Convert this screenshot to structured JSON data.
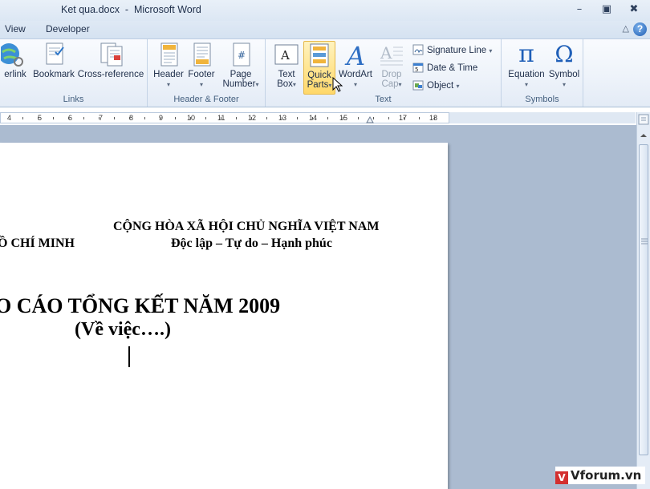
{
  "window": {
    "title": "Ket qua.docx  -  Microsoft Word",
    "controls": {
      "minimize": "–",
      "restore": "▣",
      "close": "✖"
    }
  },
  "tabs": [
    "View",
    "Developer"
  ],
  "help_label": "?",
  "ribbon": {
    "groups": {
      "links": {
        "label": "Links",
        "buttons": {
          "hyperlink": "erlink",
          "bookmark": "Bookmark",
          "cross_reference": "Cross-reference"
        }
      },
      "header_footer": {
        "label": "Header & Footer",
        "buttons": {
          "header": "Header",
          "footer": "Footer",
          "page_number_1": "Page",
          "page_number_2": "Number"
        }
      },
      "text": {
        "label": "Text",
        "buttons": {
          "text_box_1": "Text",
          "text_box_2": "Box",
          "quick_parts_1": "Quick",
          "quick_parts_2": "Parts",
          "wordart": "WordArt",
          "drop_cap_1": "Drop",
          "drop_cap_2": "Cap",
          "signature_line": "Signature Line",
          "date_time": "Date & Time",
          "object": "Object"
        }
      },
      "symbols": {
        "label": "Symbols",
        "buttons": {
          "equation": "Equation",
          "symbol": "Symbol",
          "pi_glyph": "π",
          "omega_glyph": "Ω"
        }
      }
    }
  },
  "ruler": {
    "numbers": [
      "4",
      "5",
      "6",
      "7",
      "8",
      "9",
      "10",
      "11",
      "12",
      "13",
      "14",
      "15",
      "17",
      "18"
    ]
  },
  "document": {
    "line_republic": "CỘNG HÒA XÃ HỘI CHỦ NGHĨA VIỆT NAM",
    "line_left": "Ồ CHÍ MINH",
    "line_motto": "Độc lập – Tự do – Hạnh phúc",
    "heading": "O CÁO TỔNG KẾT NĂM 2009",
    "subheading": "(Về việc….)"
  },
  "watermark": {
    "logo": "V",
    "text": "Vforum.vn"
  }
}
